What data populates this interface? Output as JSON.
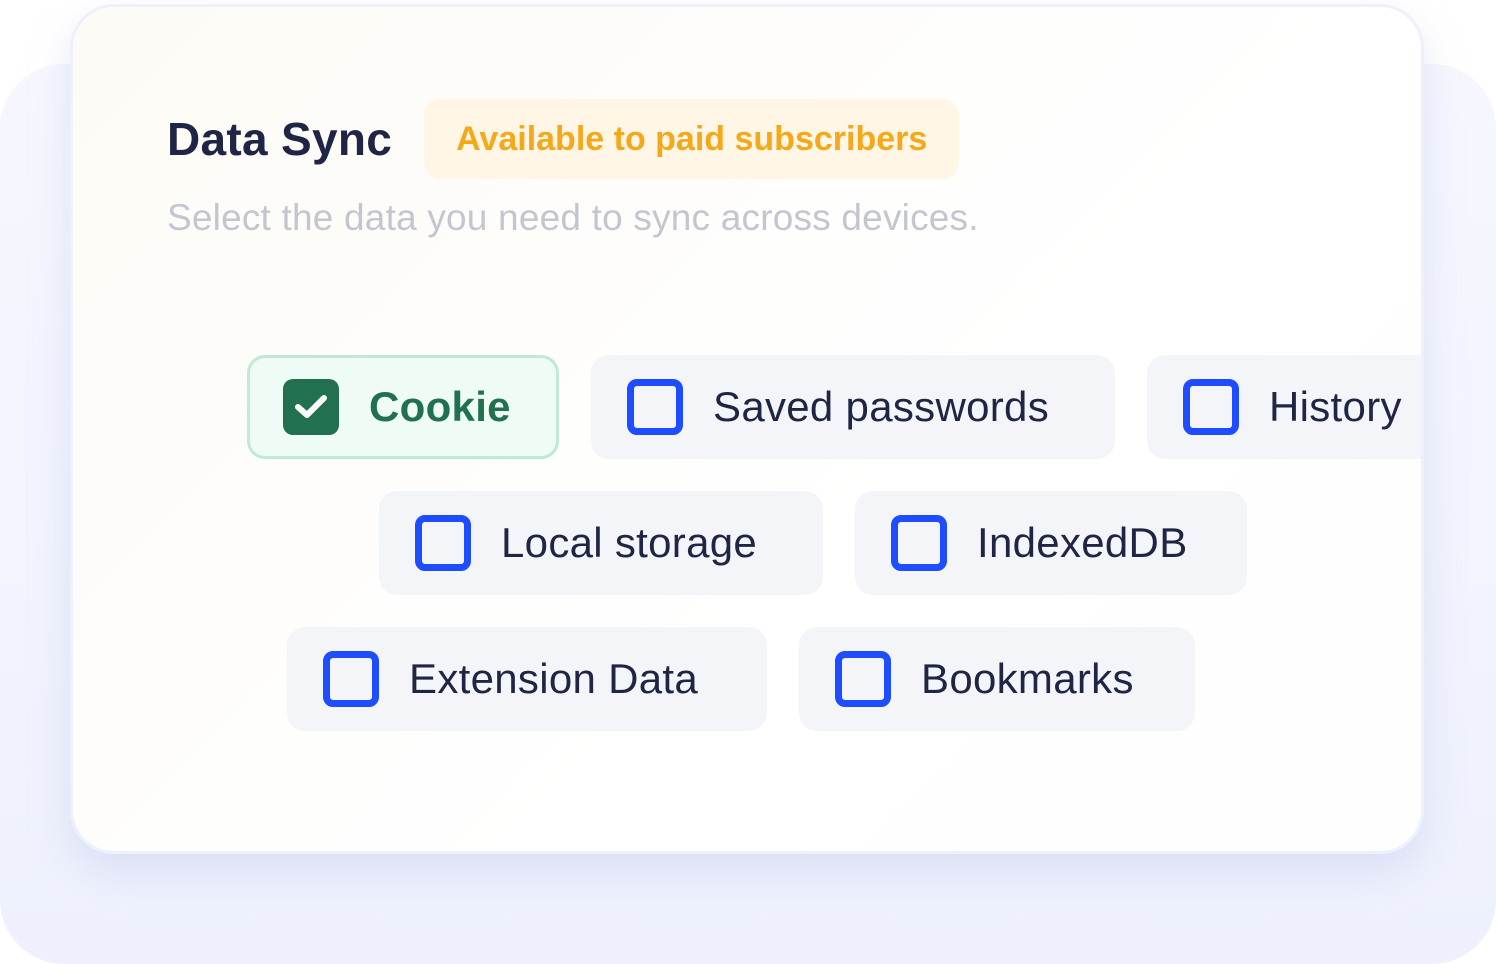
{
  "header": {
    "title": "Data Sync",
    "badge": "Available to paid subscribers",
    "subtitle": "Select the data you need to sync across devices."
  },
  "options": [
    {
      "label": "Cookie",
      "checked": true
    },
    {
      "label": "Saved passwords",
      "checked": false
    },
    {
      "label": "History",
      "checked": false
    },
    {
      "label": "Local storage",
      "checked": false
    },
    {
      "label": "IndexedDB",
      "checked": false
    },
    {
      "label": "Extension Data",
      "checked": false
    },
    {
      "label": "Bookmarks",
      "checked": false
    }
  ],
  "colors": {
    "checked_fill": "#217050",
    "unchecked_border": "#1e4dff",
    "badge_text": "#f5a81a",
    "badge_bg": "#fff6e5",
    "title": "#1f2544"
  }
}
